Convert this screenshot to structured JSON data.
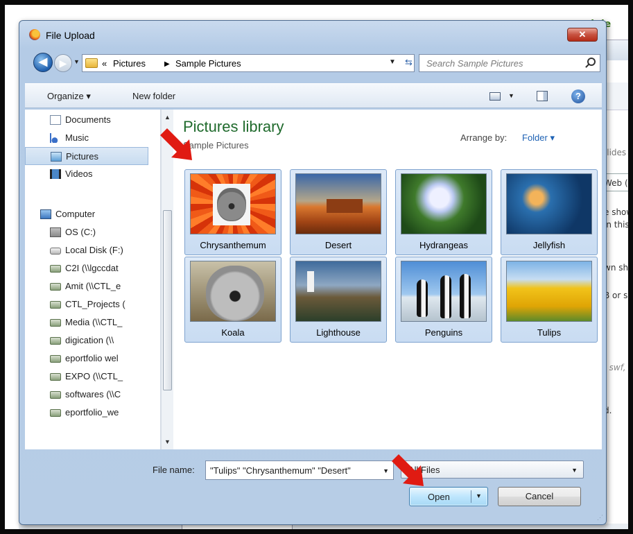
{
  "background_page": {
    "title_fragment": "dule",
    "lines": [
      "slides",
      "Web (r",
      "e show",
      "in this",
      "wn shi",
      "B or s",
      ":",
      ", swf,",
      "d."
    ]
  },
  "dialog": {
    "title": "File Upload",
    "close_label": "✕"
  },
  "address": {
    "overflow": "«",
    "crumbs": [
      "Pictures",
      "Sample Pictures"
    ],
    "search_placeholder": "Search Sample Pictures"
  },
  "toolbar": {
    "organize_label": "Organize ▾",
    "new_folder_label": "New folder"
  },
  "nav": {
    "items": [
      {
        "label": "Documents",
        "icon": "documents-icon"
      },
      {
        "label": "Music",
        "icon": "music-icon"
      },
      {
        "label": "Pictures",
        "icon": "pictures-icon",
        "selected": true
      },
      {
        "label": "Videos",
        "icon": "videos-icon"
      },
      {
        "label": "Computer",
        "icon": "computer-icon"
      },
      {
        "label": "OS (C:)",
        "icon": "os-drive-icon"
      },
      {
        "label": "Local Disk (F:)",
        "icon": "drive-icon"
      },
      {
        "label": "C2I (\\\\lgccdat",
        "icon": "network-drive-icon"
      },
      {
        "label": "Amit (\\\\CTL_e",
        "icon": "network-drive-icon"
      },
      {
        "label": "CTL_Projects (",
        "icon": "network-drive-icon"
      },
      {
        "label": "Media (\\\\CTL_",
        "icon": "network-drive-icon"
      },
      {
        "label": "digication (\\\\",
        "icon": "network-drive-icon"
      },
      {
        "label": "eportfolio wel",
        "icon": "network-drive-icon"
      },
      {
        "label": "EXPO (\\\\CTL_",
        "icon": "network-drive-icon"
      },
      {
        "label": "softwares (\\\\C",
        "icon": "network-drive-icon"
      },
      {
        "label": "eportfolio_we",
        "icon": "network-drive-icon"
      }
    ]
  },
  "content": {
    "library_title": "Pictures library",
    "library_subtitle": "Sample Pictures",
    "arrange_label": "Arrange by:",
    "arrange_value": "Folder ▾",
    "files": [
      {
        "name": "Chrysanthemum",
        "selected": true
      },
      {
        "name": "Desert",
        "selected": true
      },
      {
        "name": "Hydrangeas",
        "selected": true
      },
      {
        "name": "Jellyfish",
        "selected": true
      },
      {
        "name": "Koala",
        "selected": true
      },
      {
        "name": "Lighthouse",
        "selected": true
      },
      {
        "name": "Penguins",
        "selected": true
      },
      {
        "name": "Tulips",
        "selected": true
      }
    ]
  },
  "footer": {
    "file_name_label": "File name:",
    "file_name_value": "\"Tulips\" \"Chrysanthemum\" \"Desert\"",
    "file_type_value": "All Files",
    "open_label": "Open",
    "cancel_label": "Cancel"
  },
  "annotations": {
    "arrow_color": "#e01b12"
  }
}
